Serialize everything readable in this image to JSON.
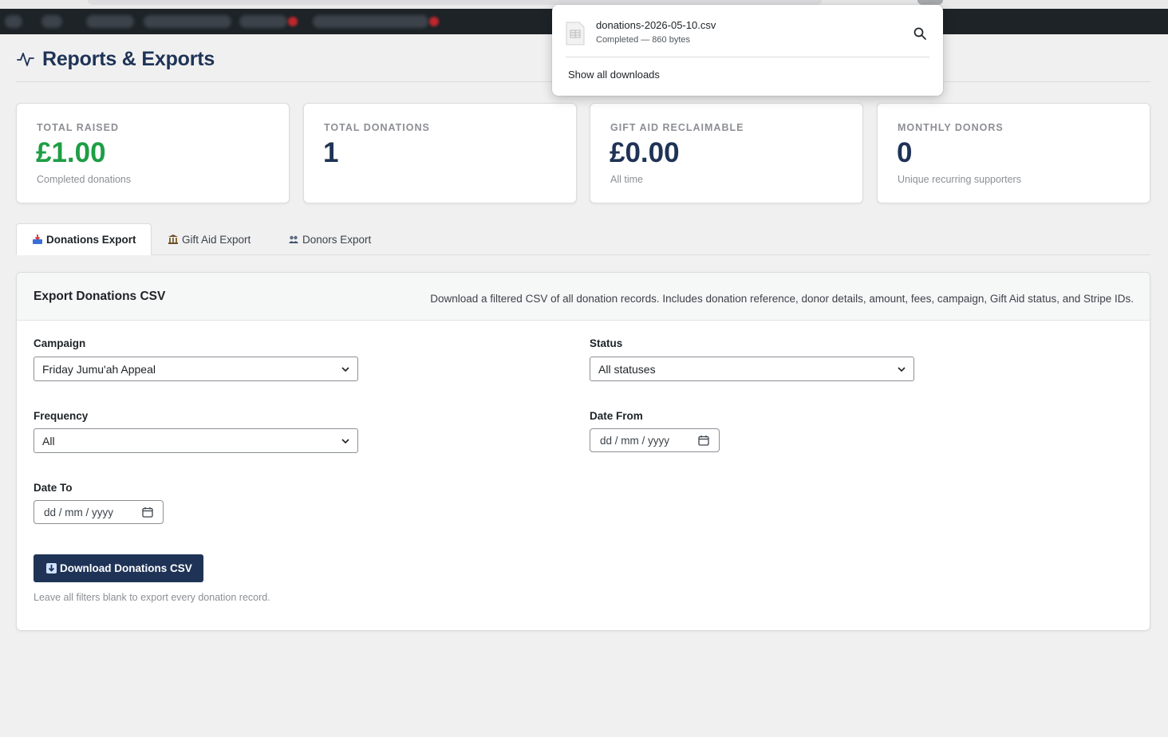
{
  "page": {
    "title": "Reports & Exports"
  },
  "stats": [
    {
      "label": "TOTAL RAISED",
      "value": "£1.00",
      "sub": "Completed donations"
    },
    {
      "label": "TOTAL DONATIONS",
      "value": "1",
      "sub": ""
    },
    {
      "label": "GIFT AID RECLAIMABLE",
      "value": "£0.00",
      "sub": "All time"
    },
    {
      "label": "MONTHLY DONORS",
      "value": "0",
      "sub": "Unique recurring supporters"
    }
  ],
  "tabs": [
    {
      "label": "Donations Export",
      "icon": "inbox-tray-icon",
      "active": true
    },
    {
      "label": "Gift Aid Export",
      "icon": "bank-icon",
      "active": false
    },
    {
      "label": "Donors Export",
      "icon": "people-icon",
      "active": false
    }
  ],
  "panel": {
    "title": "Export Donations CSV",
    "description": "Download a filtered CSV of all donation records. Includes donation reference, donor details, amount, fees, campaign, Gift Aid status, and Stripe IDs."
  },
  "filters": {
    "campaign": {
      "label": "Campaign",
      "value": "Friday Jumu'ah Appeal"
    },
    "status": {
      "label": "Status",
      "value": "All statuses"
    },
    "frequency": {
      "label": "Frequency",
      "value": "All"
    },
    "date_from": {
      "label": "Date From",
      "placeholder": "dd / mm / yyyy"
    },
    "date_to": {
      "label": "Date To",
      "placeholder": "dd / mm / yyyy"
    }
  },
  "download_button": {
    "label": "Download Donations CSV"
  },
  "hint": "Leave all filters blank to export every donation record.",
  "download_popup": {
    "filename": "donations-2026-05-10.csv",
    "status": "Completed — 860 bytes",
    "show_all": "Show all downloads"
  },
  "colors": {
    "brand_navy": "#1e3356",
    "accent_green": "#1e9e45",
    "admin_bar": "#1d2327"
  }
}
